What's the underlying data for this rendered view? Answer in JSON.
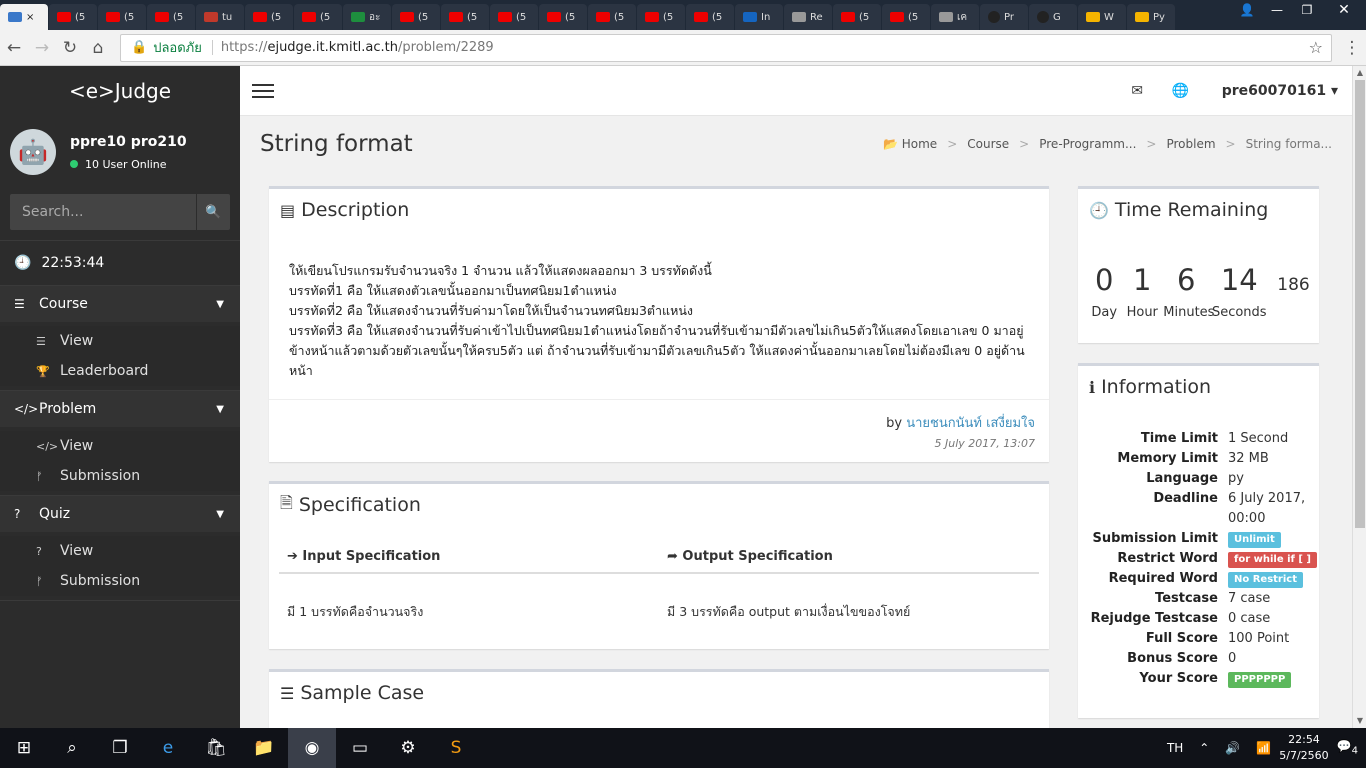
{
  "browser": {
    "tabs": [
      {
        "label": "× ",
        "kind": "web"
      },
      {
        "label": "(5",
        "kind": "yt"
      },
      {
        "label": "(5",
        "kind": "yt"
      },
      {
        "label": "(5",
        "kind": "yt"
      },
      {
        "label": "tu",
        "kind": "pdf"
      },
      {
        "label": "(5",
        "kind": "yt"
      },
      {
        "label": "(5",
        "kind": "yt"
      },
      {
        "label": "อะ",
        "kind": "n"
      },
      {
        "label": "(5",
        "kind": "yt"
      },
      {
        "label": "(5",
        "kind": "yt"
      },
      {
        "label": "(5",
        "kind": "yt"
      },
      {
        "label": "(5",
        "kind": "yt"
      },
      {
        "label": "(5",
        "kind": "yt"
      },
      {
        "label": "(5",
        "kind": "yt"
      },
      {
        "label": "(5",
        "kind": "yt"
      },
      {
        "label": "In",
        "kind": "ex"
      },
      {
        "label": "Re",
        "kind": "doc"
      },
      {
        "label": "(5",
        "kind": "yt"
      },
      {
        "label": "(5",
        "kind": "yt"
      },
      {
        "label": "เค",
        "kind": "doc"
      },
      {
        "label": "Pr",
        "kind": "gh"
      },
      {
        "label": "G",
        "kind": "gh"
      },
      {
        "label": "W",
        "kind": "ms"
      },
      {
        "label": "Py",
        "kind": "ms"
      }
    ],
    "secure_label": "ปลอดภัย",
    "url_scheme": "https://",
    "url_host": "ejudge.it.kmitl.ac.th",
    "url_path": "/problem/2289"
  },
  "sidebar": {
    "brand": "<e>Judge",
    "username": "ppre10 pro210",
    "online": "10 User Online",
    "search_placeholder": "Search...",
    "clock": "22:53:44",
    "sections": [
      {
        "title": "Course",
        "icon": "☰",
        "items": [
          {
            "label": "View",
            "icon": "☰"
          },
          {
            "label": "Leaderboard",
            "icon": "🏆"
          }
        ]
      },
      {
        "title": "Problem",
        "icon": "</>",
        "items": [
          {
            "label": "View",
            "icon": "</>"
          },
          {
            "label": "Submission",
            "icon": "ᚠ"
          }
        ]
      },
      {
        "title": "Quiz",
        "icon": "?",
        "items": [
          {
            "label": "View",
            "icon": "?"
          },
          {
            "label": "Submission",
            "icon": "ᚠ"
          }
        ]
      }
    ]
  },
  "topbar": {
    "account": "pre60070161"
  },
  "page": {
    "title": "String format",
    "breadcrumb": [
      "Home",
      "Course",
      "Pre-Programm...",
      "Problem",
      "String forma..."
    ]
  },
  "description": {
    "heading": "Description",
    "lines": [
      "ให้เขียนโปรแกรมรับจำนวนจริง 1 จำนวน แล้วให้แสดงผลออกมา 3 บรรทัดดังนี้",
      "บรรทัดที่1 คือ ให้แสดงตัวเลขนั้นออกมาเป็นทศนิยม1ตำแหน่ง",
      "บรรทัดที่2 คือ ให้แสดงจำนวนที่รับค่ามาโดยให้เป็นจำนวนทศนิยม3ตำแหน่ง",
      "บรรทัดที่3 คือ ให้แสดงจำนวนที่รับค่าเข้าไปเป็นทศนิยม1ตำแหน่งโดยถ้าจำนวนที่รับเข้ามามีตัวเลขไม่เกิน5ตัวให้แสดงโดยเอาเลข 0 มาอยู่ข้างหน้าแล้วตามด้วยตัวเลขนั้นๆให้ครบ5ตัว แต่ ถ้าจำนวนที่รับเข้ามามีตัวเลขเกิน5ตัว ให้แสดงค่านั้นออกมาเลยโดยไม่ต้องมีเลข 0 อยู่ด้านหน้า"
    ],
    "by_prefix": "by",
    "author": "นายชนกนันท์ เสงี่ยมใจ",
    "date": "5 July 2017, 13:07"
  },
  "specification": {
    "heading": "Specification",
    "input_heading": "Input Specification",
    "output_heading": "Output Specification",
    "input": "มี 1 บรรทัดคือจำนวนจริง",
    "output": "มี 3 บรรทัดคือ output ตามเงื่อนไขของโจทย์"
  },
  "sample": {
    "heading": "Sample Case"
  },
  "timer": {
    "heading": "Time Remaining",
    "day": "0",
    "hour": "1",
    "minutes": "6",
    "seconds": "14",
    "millis": "186",
    "day_label": "Day",
    "hour_label": "Hour",
    "minutes_label": "Minutes",
    "seconds_label": "Seconds"
  },
  "information": {
    "heading": "Information",
    "rows": [
      {
        "k": "Time Limit",
        "v": "1 Second"
      },
      {
        "k": "Memory Limit",
        "v": "32 MB"
      },
      {
        "k": "Language",
        "v": "py"
      },
      {
        "k": "Deadline",
        "v": "6 July 2017, 00:00"
      },
      {
        "k": "Submission Limit",
        "v": "Unlimit",
        "badge": "blue"
      },
      {
        "k": "Restrict Word",
        "v": "for while if [ ]",
        "badge": "red"
      },
      {
        "k": "Required Word",
        "v": "No Restrict",
        "badge": "blue"
      },
      {
        "k": "Testcase",
        "v": "7 case"
      },
      {
        "k": "Rejudge Testcase",
        "v": "0 case"
      },
      {
        "k": "Full Score",
        "v": "100 Point"
      },
      {
        "k": "Bonus Score",
        "v": "0"
      },
      {
        "k": "Your Score",
        "v": "PPPPPPP",
        "badge": "green"
      }
    ]
  },
  "taskbar": {
    "lang": "TH",
    "time": "22:54",
    "date": "5/7/2560",
    "notifications": "4"
  }
}
